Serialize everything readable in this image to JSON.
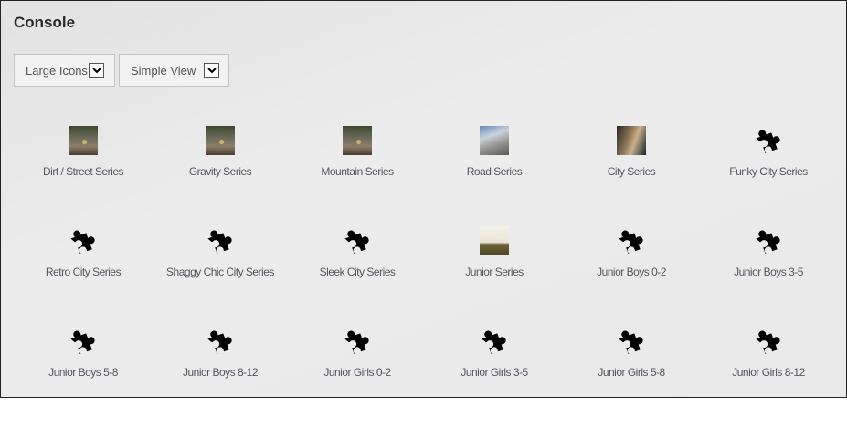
{
  "header": {
    "title": "Console"
  },
  "controls": {
    "size_select": "Large Icons",
    "view_select": "Simple View"
  },
  "items": [
    {
      "label": "Dirt / Street Series",
      "icon": "photo-dirt"
    },
    {
      "label": "Gravity Series",
      "icon": "photo-dirt"
    },
    {
      "label": "Mountain Series",
      "icon": "photo-dirt"
    },
    {
      "label": "Road Series",
      "icon": "photo-road"
    },
    {
      "label": "City Series",
      "icon": "photo-city"
    },
    {
      "label": "Funky City Series",
      "icon": "puzzle-icon"
    },
    {
      "label": "Retro City Series",
      "icon": "puzzle-icon"
    },
    {
      "label": "Shaggy Chic City Series",
      "icon": "puzzle-icon"
    },
    {
      "label": "Sleek City Series",
      "icon": "puzzle-icon"
    },
    {
      "label": "Junior Series",
      "icon": "photo-junior"
    },
    {
      "label": "Junior Boys 0-2",
      "icon": "puzzle-icon"
    },
    {
      "label": "Junior Boys 3-5",
      "icon": "puzzle-icon"
    },
    {
      "label": "Junior Boys 5-8",
      "icon": "puzzle-icon"
    },
    {
      "label": "Junior Boys 8-12",
      "icon": "puzzle-icon"
    },
    {
      "label": "Junior Girls 0-2",
      "icon": "puzzle-icon"
    },
    {
      "label": "Junior Girls 3-5",
      "icon": "puzzle-icon"
    },
    {
      "label": "Junior Girls 5-8",
      "icon": "puzzle-icon"
    },
    {
      "label": "Junior Girls 8-12",
      "icon": "puzzle-icon"
    }
  ]
}
